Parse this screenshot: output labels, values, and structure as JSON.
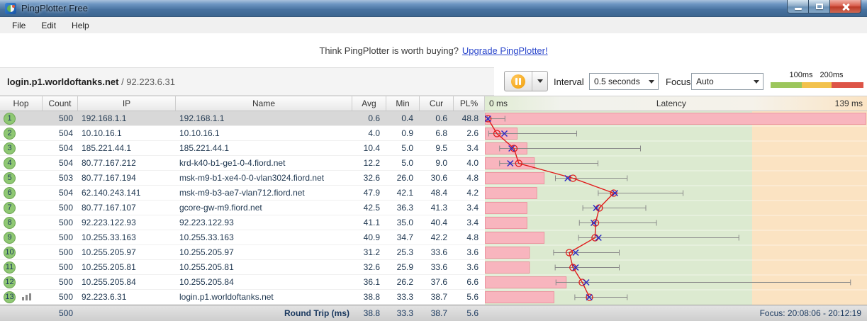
{
  "window": {
    "title": "PingPlotter Free"
  },
  "menu": {
    "items": [
      "File",
      "Edit",
      "Help"
    ]
  },
  "banner": {
    "question": "Think PingPlotter is worth buying?",
    "link": "Upgrade PingPlotter!"
  },
  "toolbar": {
    "target_host": "login.p1.worldoftanks.net",
    "target_ip": " / 92.223.6.31",
    "interval_label": "Interval",
    "interval_value": "0.5 seconds",
    "focus_label": "Focus",
    "focus_value": "Auto",
    "legend": {
      "labels": [
        "100ms",
        "200ms"
      ],
      "colors": [
        "#9cc65c",
        "#f2c24d",
        "#dd5447"
      ]
    }
  },
  "table": {
    "columns": {
      "hop": "Hop",
      "count": "Count",
      "ip": "IP",
      "name": "Name",
      "avg": "Avg",
      "min": "Min",
      "cur": "Cur",
      "pl": "PL%"
    },
    "latency_header": {
      "left": "0 ms",
      "center": "Latency",
      "right": "139 ms"
    },
    "graph": {
      "min_ms": 0,
      "max_ms": 139,
      "green_until_ms": 100,
      "colors": {
        "zone_ok": "#dcead0",
        "zone_warn": "#fbe3c2",
        "loss_bar": "#f8b5be",
        "loss_bar_border": "#ec95a1",
        "avg_line": "#e01b1b",
        "cur_mark": "#2b2bc4",
        "range_whisker": "#8a8a8a"
      }
    },
    "rows": [
      {
        "hop": 1,
        "count": "500",
        "ip": "192.168.1.1",
        "name": "192.168.1.1",
        "avg": "0.6",
        "min": "0.4",
        "cur": "0.6",
        "pl": "48.8",
        "max_ms": 7,
        "selected": true
      },
      {
        "hop": 2,
        "count": "504",
        "ip": "10.10.16.1",
        "name": "10.10.16.1",
        "avg": "4.0",
        "min": "0.9",
        "cur": "6.8",
        "pl": "2.6",
        "max_ms": 34
      },
      {
        "hop": 3,
        "count": "504",
        "ip": "185.221.44.1",
        "name": "185.221.44.1",
        "avg": "10.4",
        "min": "5.0",
        "cur": "9.5",
        "pl": "3.4",
        "max_ms": 58
      },
      {
        "hop": 4,
        "count": "504",
        "ip": "80.77.167.212",
        "name": "krd-k40-b1-ge1-0-4.fiord.net",
        "avg": "12.2",
        "min": "5.0",
        "cur": "9.0",
        "pl": "4.0",
        "max_ms": 42
      },
      {
        "hop": 5,
        "count": "503",
        "ip": "80.77.167.194",
        "name": "msk-m9-b1-xe4-0-0-vlan3024.fiord.net",
        "avg": "32.6",
        "min": "26.0",
        "cur": "30.6",
        "pl": "4.8",
        "max_ms": 53
      },
      {
        "hop": 6,
        "count": "504",
        "ip": "62.140.243.141",
        "name": "msk-m9-b3-ae7-vlan712.fiord.net",
        "avg": "47.9",
        "min": "42.1",
        "cur": "48.4",
        "pl": "4.2",
        "max_ms": 74
      },
      {
        "hop": 7,
        "count": "500",
        "ip": "80.77.167.107",
        "name": "gcore-gw-m9.fiord.net",
        "avg": "42.5",
        "min": "36.3",
        "cur": "41.3",
        "pl": "3.4",
        "max_ms": 60
      },
      {
        "hop": 8,
        "count": "500",
        "ip": "92.223.122.93",
        "name": "92.223.122.93",
        "avg": "41.1",
        "min": "35.0",
        "cur": "40.4",
        "pl": "3.4",
        "max_ms": 64
      },
      {
        "hop": 9,
        "count": "500",
        "ip": "10.255.33.163",
        "name": "10.255.33.163",
        "avg": "40.9",
        "min": "34.7",
        "cur": "42.2",
        "pl": "4.8",
        "max_ms": 95
      },
      {
        "hop": 10,
        "count": "500",
        "ip": "10.255.205.97",
        "name": "10.255.205.97",
        "avg": "31.2",
        "min": "25.3",
        "cur": "33.6",
        "pl": "3.6",
        "max_ms": 50
      },
      {
        "hop": 11,
        "count": "500",
        "ip": "10.255.205.81",
        "name": "10.255.205.81",
        "avg": "32.6",
        "min": "25.9",
        "cur": "33.6",
        "pl": "3.6",
        "max_ms": 50
      },
      {
        "hop": 12,
        "count": "500",
        "ip": "10.255.205.84",
        "name": "10.255.205.84",
        "avg": "36.1",
        "min": "26.2",
        "cur": "37.6",
        "pl": "6.6",
        "max_ms": 137
      },
      {
        "hop": 13,
        "count": "500",
        "ip": "92.223.6.31",
        "name": "login.p1.worldoftanks.net",
        "avg": "38.8",
        "min": "33.3",
        "cur": "38.7",
        "pl": "5.6",
        "max_ms": 53,
        "chart_icon": true
      }
    ],
    "footer": {
      "count": "500",
      "label": "Round Trip (ms)",
      "avg": "38.8",
      "min": "33.3",
      "cur": "38.7",
      "pl": "5.6",
      "focus": "Focus: 20:08:06 - 20:12:19"
    }
  }
}
